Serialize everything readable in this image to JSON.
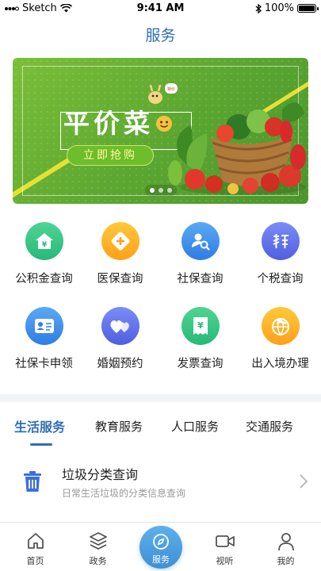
{
  "status_bar": {
    "carrier": "Sketch",
    "time": "9:41 AM",
    "battery": "100%",
    "battery_level": 1.0
  },
  "nav": {
    "title": "服务"
  },
  "banner": {
    "title": "平价菜",
    "cta": "立即抢购",
    "page_count": 3,
    "active_page": 1
  },
  "services": [
    {
      "label": "公积金查询",
      "icon": "housing-fund-icon",
      "color_from": "#4fd493",
      "color_to": "#27b978"
    },
    {
      "label": "医保查询",
      "icon": "medical-insurance-icon",
      "color_from": "#ffc93a",
      "color_to": "#ff9f1a"
    },
    {
      "label": "社保查询",
      "icon": "social-security-search-icon",
      "color_from": "#5aa9f5",
      "color_to": "#2f7de3"
    },
    {
      "label": "个税查询",
      "icon": "tax-icon",
      "color_from": "#7b8cf7",
      "color_to": "#4f5fe0"
    },
    {
      "label": "社保卡申领",
      "icon": "id-card-icon",
      "color_from": "#5aa9f5",
      "color_to": "#2f7de3"
    },
    {
      "label": "婚姻预约",
      "icon": "hearts-icon",
      "color_from": "#7b8cf7",
      "color_to": "#4f5fe0"
    },
    {
      "label": "发票查询",
      "icon": "invoice-icon",
      "color_from": "#4fd493",
      "color_to": "#27b978"
    },
    {
      "label": "出入境办理",
      "icon": "plane-globe-icon",
      "color_from": "#ffc93a",
      "color_to": "#ff9f1a"
    }
  ],
  "tabs": [
    {
      "label": "生活服务",
      "active": true
    },
    {
      "label": "教育服务",
      "active": false
    },
    {
      "label": "人口服务",
      "active": false
    },
    {
      "label": "交通服务",
      "active": false
    }
  ],
  "list": [
    {
      "title": "垃圾分类查询",
      "subtitle": "日常生活垃圾的分类信息查询",
      "icon": "trash-icon"
    }
  ],
  "tabbar": [
    {
      "label": "首页",
      "icon": "home-icon"
    },
    {
      "label": "政务",
      "icon": "layers-icon"
    },
    {
      "label": "服务",
      "icon": "compass-icon",
      "active": true
    },
    {
      "label": "视听",
      "icon": "video-icon"
    },
    {
      "label": "我的",
      "icon": "user-icon"
    }
  ],
  "colors": {
    "accent": "#2f6fb5",
    "banner_green": "#5aa631",
    "tab_active_gradient": "#3f8fd6"
  }
}
